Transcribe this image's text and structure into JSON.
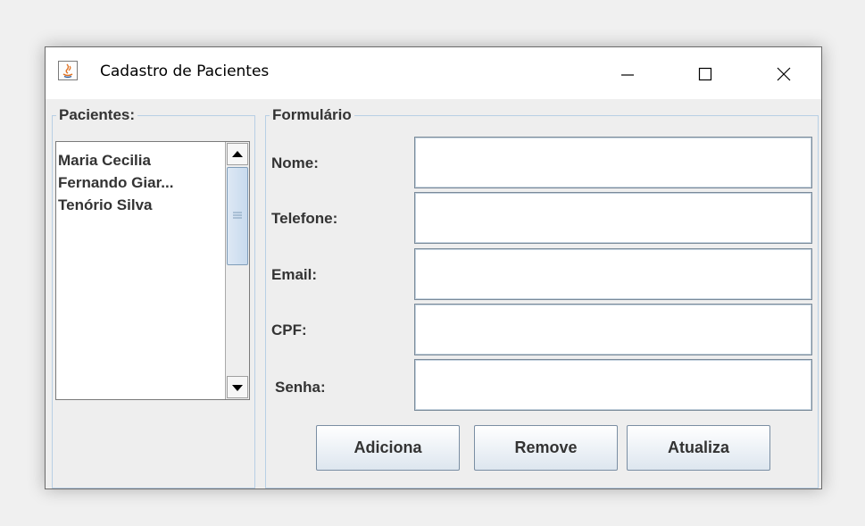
{
  "window": {
    "title": "Cadastro de Pacientes"
  },
  "pacientes": {
    "legend": "Pacientes:",
    "items": [
      "Maria Cecilia",
      "Fernando Giar...",
      "Tenório Silva"
    ]
  },
  "form": {
    "legend": "Formulário",
    "fields": [
      {
        "label": "Nome:",
        "value": ""
      },
      {
        "label": "Telefone:",
        "value": ""
      },
      {
        "label": "Email:",
        "value": ""
      },
      {
        "label": "CPF:",
        "value": ""
      },
      {
        "label": "Senha:",
        "value": ""
      }
    ],
    "buttons": {
      "add": "Adiciona",
      "remove": "Remove",
      "update": "Atualiza"
    }
  }
}
